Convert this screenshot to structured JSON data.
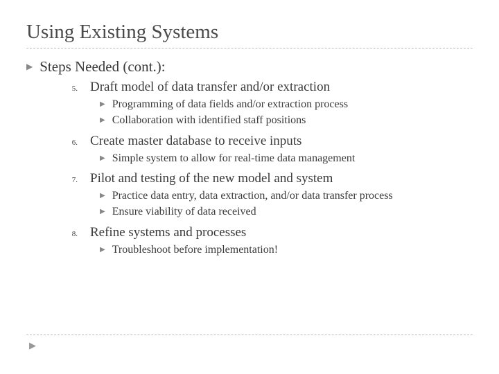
{
  "title": "Using Existing Systems",
  "section_title": "Steps Needed (cont.):",
  "steps": [
    {
      "num": "5.",
      "title": "Draft model of data transfer and/or extraction",
      "subs": [
        "Programming of data fields and/or extraction process",
        "Collaboration with identified staff positions"
      ]
    },
    {
      "num": "6.",
      "title": "Create master database to receive inputs",
      "subs": [
        "Simple system to allow for real-time data management"
      ]
    },
    {
      "num": "7.",
      "title": "Pilot and testing of the new model and system",
      "subs": [
        "Practice data entry, data extraction, and/or data transfer process",
        "Ensure viability of data received"
      ]
    },
    {
      "num": "8.",
      "title": "Refine systems and processes",
      "subs": [
        "Troubleshoot before implementation!"
      ]
    }
  ]
}
